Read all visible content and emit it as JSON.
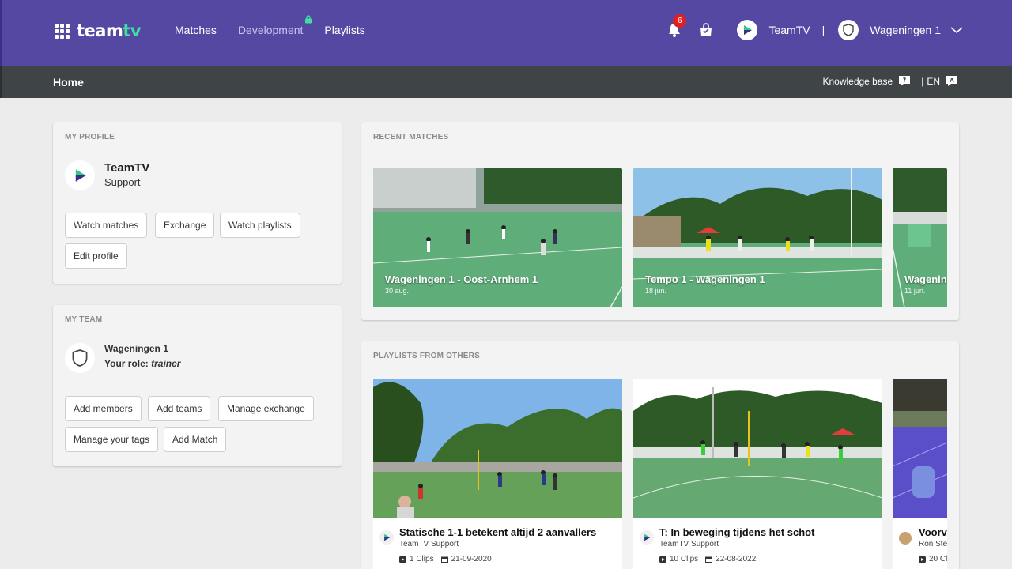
{
  "brand": {
    "logo_part1": "team",
    "logo_part2": "tv"
  },
  "nav": {
    "matches": "Matches",
    "development": "Development",
    "playlists": "Playlists"
  },
  "header": {
    "notification_count": "6",
    "user_name": "TeamTV",
    "separator": "|",
    "team_name": "Wageningen 1"
  },
  "subbar": {
    "breadcrumb": "Home",
    "knowledge_base": "Knowledge base",
    "lang_sep": "|",
    "language": "EN"
  },
  "profile": {
    "section_title": "MY PROFILE",
    "name": "TeamTV",
    "role": "Support",
    "buttons": [
      "Watch matches",
      "Exchange",
      "Watch playlists",
      "Edit profile"
    ]
  },
  "team": {
    "section_title": "MY TEAM",
    "name": "Wageningen 1",
    "role_label": "Your role:",
    "role_value": "trainer",
    "buttons": [
      "Add members",
      "Add teams",
      "Manage exchange",
      "Manage your tags",
      "Add Match"
    ]
  },
  "recent_matches": {
    "section_title": "RECENT MATCHES",
    "items": [
      {
        "title": "Wageningen 1 - Oost-Arnhem 1",
        "date": "30 aug."
      },
      {
        "title": "Tempo 1 - Wageningen 1",
        "date": "18 jun."
      },
      {
        "title": "Wagenin",
        "date": "11 jun."
      }
    ]
  },
  "playlists": {
    "section_title": "PLAYLISTS FROM OTHERS",
    "items": [
      {
        "title": "Statische 1-1 betekent altijd 2 aanvallers",
        "author": "TeamTV Support",
        "clips": "1 Clips",
        "date": "21-09-2020"
      },
      {
        "title": "T: In beweging tijdens het schot",
        "author": "TeamTV Support",
        "clips": "10 Clips",
        "date": "22-08-2022"
      },
      {
        "title": "Voorv",
        "author": "Ron Ste",
        "clips": "20 Cl",
        "date": ""
      }
    ]
  },
  "colors": {
    "topbar": "#5548a3",
    "subbar": "#3f4447",
    "accent": "#3ce0a0",
    "badge": "#e02020"
  }
}
